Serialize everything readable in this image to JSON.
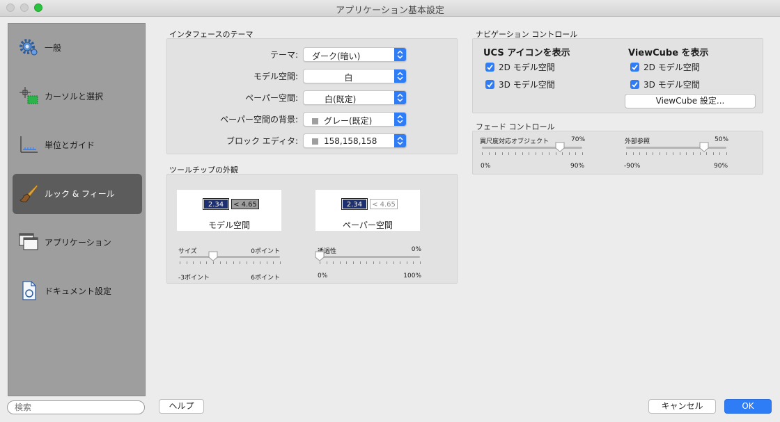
{
  "window": {
    "title": "アプリケーション基本設定"
  },
  "sidebar": {
    "items": [
      {
        "label": "一般",
        "icon": "gear-icon"
      },
      {
        "label": "カーソルと選択",
        "icon": "cursor-select-icon"
      },
      {
        "label": "単位とガイド",
        "icon": "units-guide-icon"
      },
      {
        "label": "ルック & フィール",
        "icon": "brush-icon",
        "selected": true
      },
      {
        "label": "アプリケーション",
        "icon": "windows-icon"
      },
      {
        "label": "ドキュメント設定",
        "icon": "document-icon"
      }
    ],
    "search_placeholder": "検索"
  },
  "interface_theme": {
    "title": "インタフェースのテーマ",
    "rows": [
      {
        "label": "テーマ:",
        "value": "ダーク(暗い)"
      },
      {
        "label": "モデル空間:",
        "value": "白"
      },
      {
        "label": "ペーパー空間:",
        "value": "白(既定)"
      },
      {
        "label": "ペーパー空間の背景:",
        "value": "グレー(既定)"
      },
      {
        "label": "ブロック エディタ:",
        "value": "158,158,158"
      }
    ]
  },
  "tooltip": {
    "title": "ツールチップの外観",
    "model": {
      "caption": "モデル空間",
      "val1": "2.34",
      "val2": "< 4.65"
    },
    "paper": {
      "caption": "ペーパー空間",
      "val1": "2.34",
      "val2": "< 4.65"
    },
    "size_slider": {
      "label": "サイズ",
      "value": "0ポイント",
      "min": "-3ポイント",
      "max": "6ポイント",
      "level": 0.333
    },
    "transparency_slider": {
      "label": "透過性",
      "value": "0%",
      "min": "0%",
      "max": "100%",
      "level": 0
    }
  },
  "navigation": {
    "title": "ナビゲーション コントロール",
    "ucs": {
      "header": "UCS アイコンを表示",
      "opt2d": "2D モデル空間",
      "opt3d": "3D モデル空間",
      "checked2d": true,
      "checked3d": true
    },
    "viewcube": {
      "header": "ViewCube を表示",
      "opt2d": "2D モデル空間",
      "opt3d": "3D モデル空間",
      "checked2d": true,
      "checked3d": true,
      "settings_button": "ViewCube 設定..."
    }
  },
  "fade": {
    "title": "フェード コントロール",
    "annotative": {
      "label": "異尺度対応オブジェクト",
      "value": "70%",
      "min": "0%",
      "max": "90%",
      "level": 0.778
    },
    "xref": {
      "label": "外部参照",
      "value": "50%",
      "min": "-90%",
      "max": "90%",
      "level": 0.778
    }
  },
  "buttons": {
    "help": "ヘルプ",
    "cancel": "キャンセル",
    "ok": "OK"
  },
  "colors": {
    "accent": "#2e7cf6",
    "selected_item": "#5c5c5c",
    "sidebar": "#9e9e9e"
  }
}
